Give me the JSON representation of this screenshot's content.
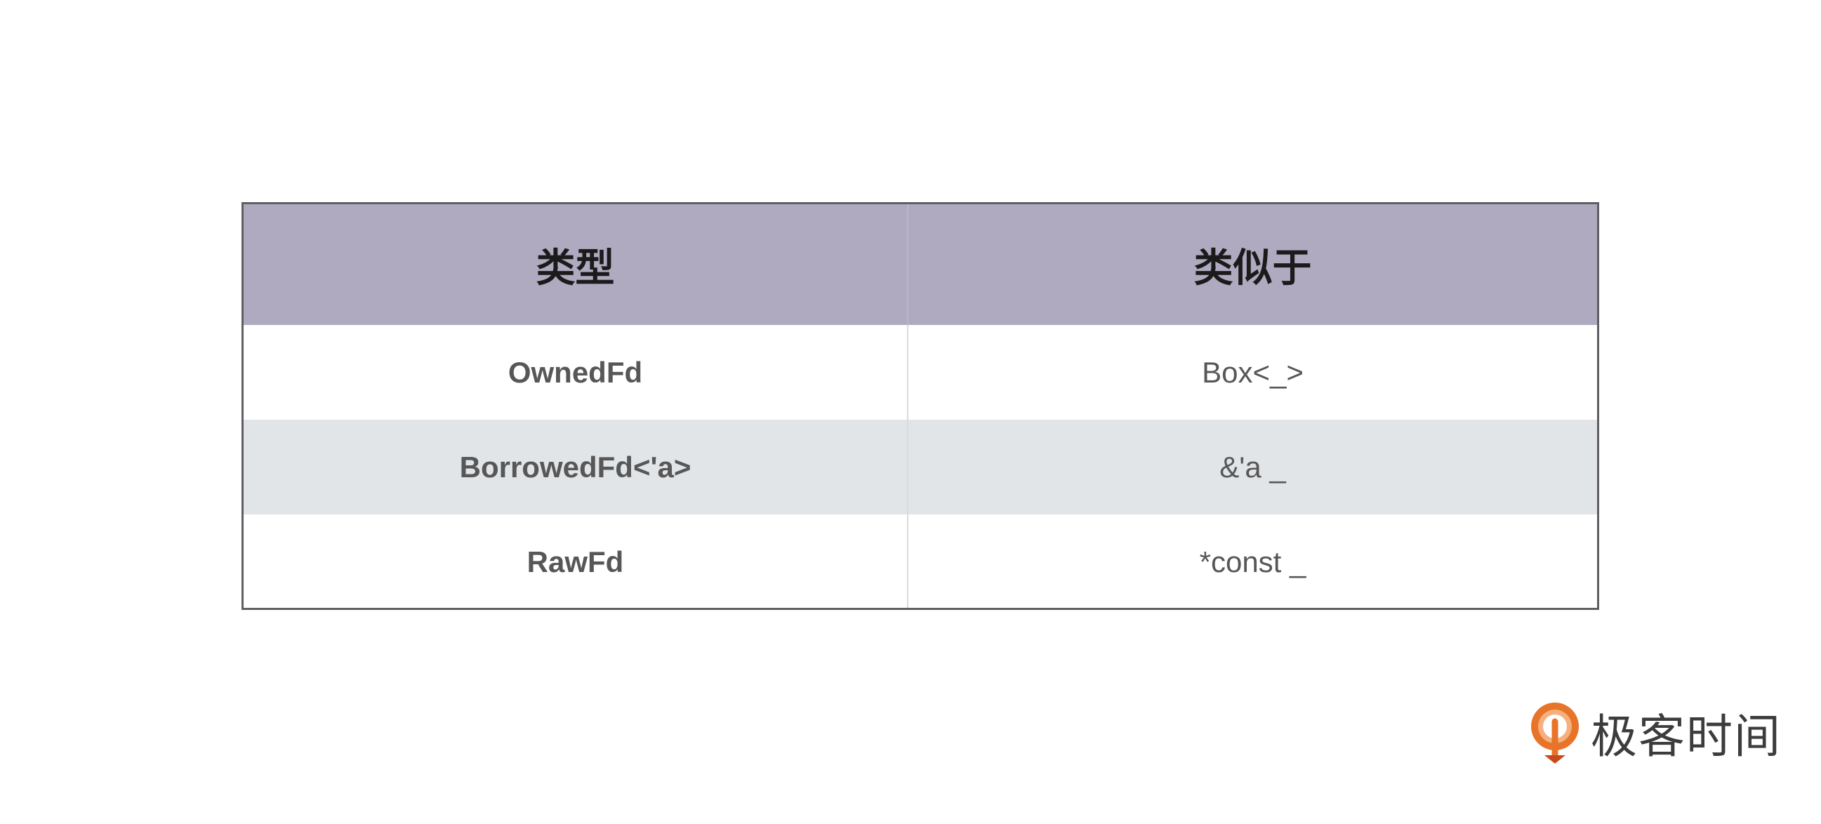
{
  "table": {
    "headers": [
      "类型",
      "类似于"
    ],
    "rows": [
      {
        "type": "OwnedFd",
        "similar": "Box<_>"
      },
      {
        "type": "BorrowedFd<'a>",
        "similar": "&'a _"
      },
      {
        "type": "RawFd",
        "similar": "*const _"
      }
    ]
  },
  "brand": {
    "name": "极客时间",
    "logo_color": "#e8742a"
  },
  "colors": {
    "header_bg": "#afaabf",
    "stripe_bg": "#e2e5e8",
    "border": "#5f5f63"
  }
}
